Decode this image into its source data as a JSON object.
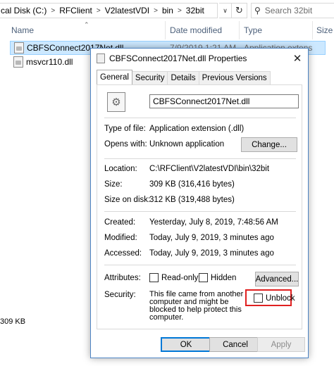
{
  "explorer": {
    "breadcrumb": [
      "cal Disk (C:)",
      "RFClient",
      "V2latestVDI",
      "bin",
      "32bit"
    ],
    "search_placeholder": "Search 32bit",
    "columns": {
      "name": "Name",
      "date": "Date modified",
      "type": "Type",
      "size": "Size"
    },
    "files": [
      {
        "name": "CBFSConnect2017Net.dll",
        "date": "7/9/2019 1:21 AM",
        "type": "Application extens"
      },
      {
        "name": "msvcr110.dll",
        "date": "",
        "type": ""
      }
    ],
    "status_size": "309 KB",
    "icons": {
      "dropdown": "chevron-down-icon",
      "refresh": "refresh-icon",
      "search": "search-icon",
      "file": "dll-file-icon"
    }
  },
  "dialog": {
    "title": "CBFSConnect2017Net.dll Properties",
    "tabs": [
      "General",
      "Security",
      "Details",
      "Previous Versions"
    ],
    "active_tab": "General",
    "file_name": "CBFSConnect2017Net.dll",
    "type_label": "Type of file:",
    "type_value": "Application extension (.dll)",
    "opens_label": "Opens with:",
    "opens_value": "Unknown application",
    "change_button": "Change...",
    "location_label": "Location:",
    "location_value": "C:\\RFClient\\V2latestVDI\\bin\\32bit",
    "size_label": "Size:",
    "size_value": "309 KB (316,416 bytes)",
    "size_disk_label": "Size on disk:",
    "size_disk_value": "312 KB (319,488 bytes)",
    "created_label": "Created:",
    "created_value": "Yesterday, July 8, 2019, 7:48:56 AM",
    "modified_label": "Modified:",
    "modified_value": "Today, July 9, 2019, 3 minutes ago",
    "accessed_label": "Accessed:",
    "accessed_value": "Today, July 9, 2019, 3 minutes ago",
    "attributes_label": "Attributes:",
    "readonly_label": "Read-only",
    "hidden_label": "Hidden",
    "advanced_button": "Advanced...",
    "security_label": "Security:",
    "security_text": "This file came from another computer and might be blocked to help protect this computer.",
    "unblock_label": "Unblock",
    "ok_button": "OK",
    "cancel_button": "Cancel",
    "apply_button": "Apply",
    "highlight_color": "#e02020"
  }
}
